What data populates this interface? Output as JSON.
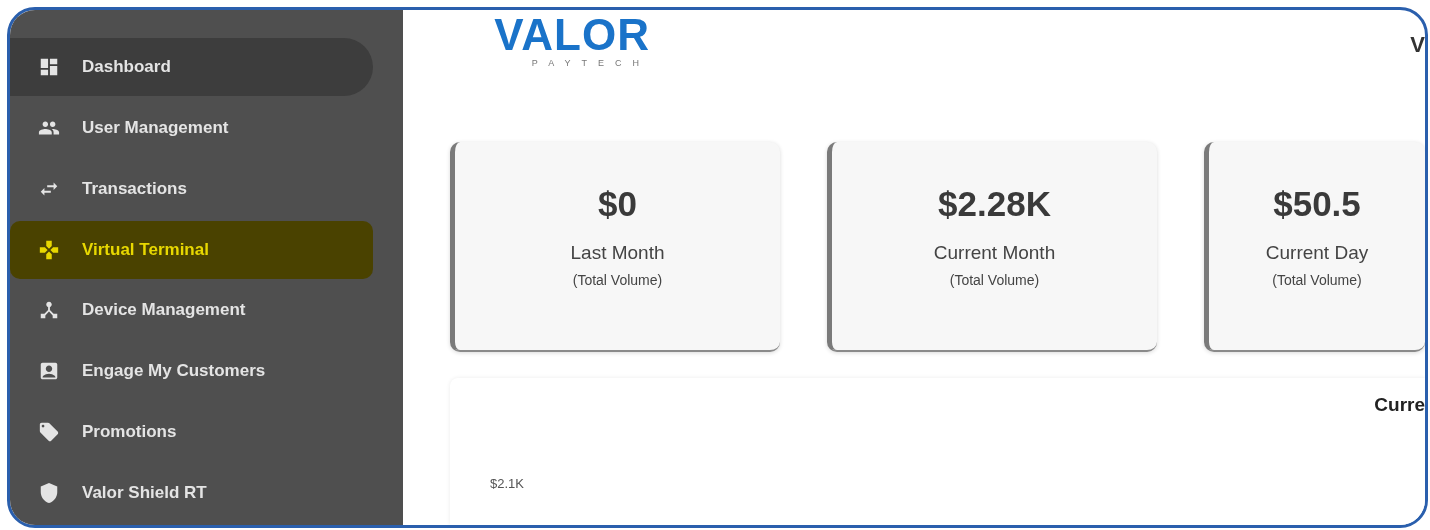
{
  "sidebar": {
    "items": [
      {
        "label": "Dashboard",
        "selected": false,
        "hovered": true
      },
      {
        "label": "User Management",
        "selected": false,
        "hovered": false
      },
      {
        "label": "Transactions",
        "selected": false,
        "hovered": false
      },
      {
        "label": "Virtual Terminal",
        "selected": true,
        "hovered": false
      },
      {
        "label": "Device Management",
        "selected": false,
        "hovered": false
      },
      {
        "label": "Engage My Customers",
        "selected": false,
        "hovered": false
      },
      {
        "label": "Promotions",
        "selected": false,
        "hovered": false
      },
      {
        "label": "Valor Shield RT",
        "selected": false,
        "hovered": false
      }
    ]
  },
  "header": {
    "logo": {
      "wordmark": "VALOR",
      "tagline": "PAYTECH"
    },
    "right_text": "V"
  },
  "cards": [
    {
      "value": "$0",
      "label": "Last Month",
      "sublabel": "(Total Volume)"
    },
    {
      "value": "$2.28K",
      "label": "Current Month",
      "sublabel": "(Total Volume)"
    },
    {
      "value": "$50.5",
      "label": "Current Day",
      "sublabel": "(Total Volume)"
    }
  ],
  "chart": {
    "title": "Curre",
    "y_tick": "$2.1K"
  }
}
